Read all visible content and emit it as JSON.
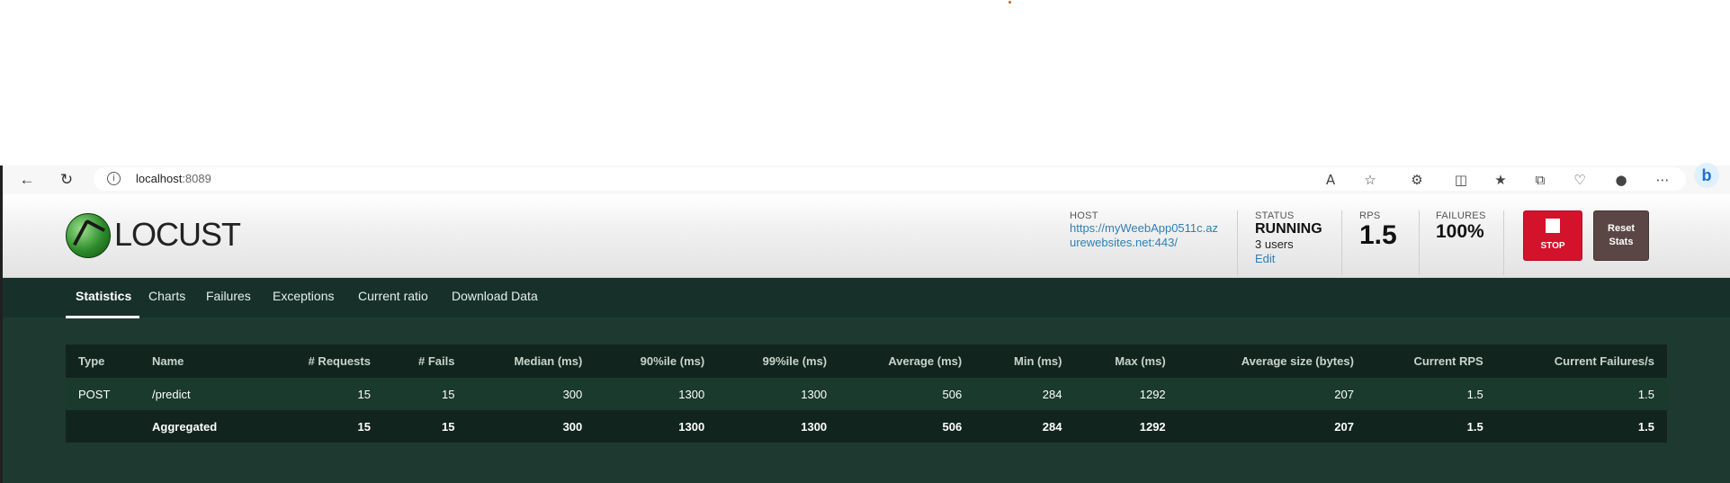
{
  "browser": {
    "url_host": "localhost",
    "url_port": ":8089"
  },
  "locust": {
    "logo_text": "LOCUST",
    "host_label": "HOST",
    "host_url": "https://myWeebApp0511c.azurewebsites.net:443/",
    "status_label": "STATUS",
    "status_value": "RUNNING",
    "users": "3 users",
    "edit_label": "Edit",
    "rps_label": "RPS",
    "rps_value": "1.5",
    "failures_label": "FAILURES",
    "failures_value": "100%",
    "stop_label": "STOP",
    "reset_label_1": "Reset",
    "reset_label_2": "Stats"
  },
  "tabs": [
    "Statistics",
    "Charts",
    "Failures",
    "Exceptions",
    "Current ratio",
    "Download Data"
  ],
  "table": {
    "headers": [
      "Type",
      "Name",
      "# Requests",
      "# Fails",
      "Median (ms)",
      "90%ile (ms)",
      "99%ile (ms)",
      "Average (ms)",
      "Min (ms)",
      "Max (ms)",
      "Average size (bytes)",
      "Current RPS",
      "Current Failures/s"
    ],
    "rows": [
      [
        "POST",
        "/predict",
        "15",
        "15",
        "300",
        "1300",
        "1300",
        "506",
        "284",
        "1292",
        "207",
        "1.5",
        "1.5"
      ],
      [
        "",
        "Aggregated",
        "15",
        "15",
        "300",
        "1300",
        "1300",
        "506",
        "284",
        "1292",
        "207",
        "1.5",
        "1.5"
      ]
    ]
  },
  "colors": {
    "stop": "#d2132b",
    "reset": "#5b4646",
    "main_bg": "#1e3a30",
    "link": "#2e7fb5"
  }
}
